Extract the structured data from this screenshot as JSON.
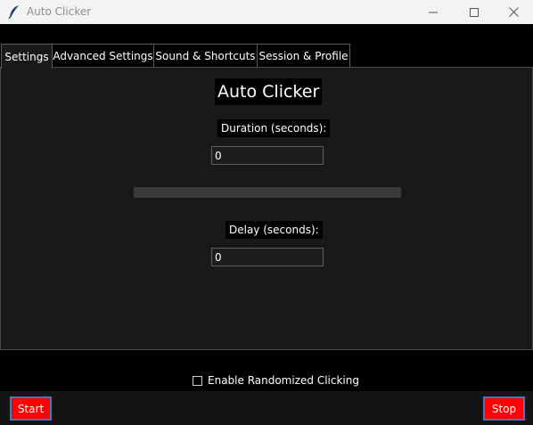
{
  "window": {
    "title": "Auto Clicker",
    "icon": "feather-icon"
  },
  "tabs": [
    {
      "label": "Settings",
      "active": true
    },
    {
      "label": "Advanced Settings",
      "active": false
    },
    {
      "label": "Sound & Shortcuts",
      "active": false
    },
    {
      "label": "Session & Profile",
      "active": false
    }
  ],
  "settings": {
    "heading": "Auto Clicker",
    "duration_label": "Duration (seconds):",
    "duration_value": "0",
    "progress": 0,
    "delay_label": "Delay (seconds):",
    "delay_value": "0"
  },
  "randomized": {
    "label": "Enable Randomized Clicking",
    "checked": false
  },
  "actions": {
    "start_label": "Start",
    "stop_label": "Stop"
  },
  "colors": {
    "button_bg": "#ff0000",
    "button_border": "#3e7fb8",
    "panel_bg": "#191919",
    "window_bg": "#000000"
  }
}
